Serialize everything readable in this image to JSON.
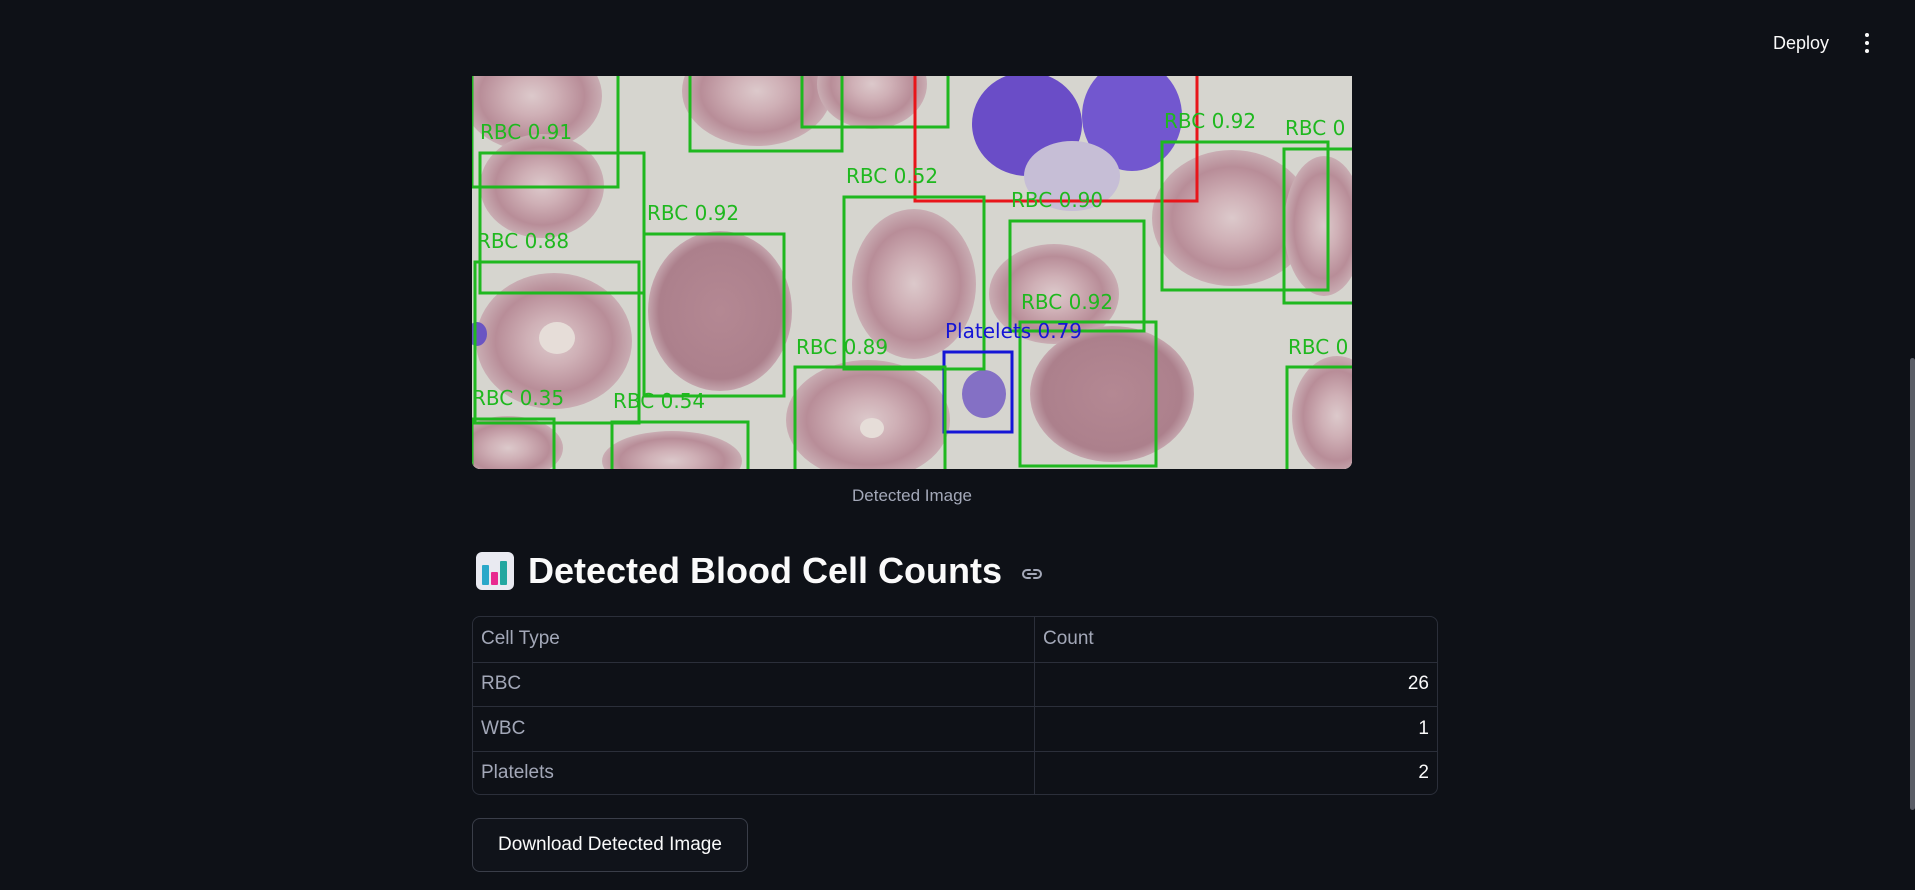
{
  "header": {
    "deploy_label": "Deploy",
    "menu_icon": "vertical-dots-icon"
  },
  "image": {
    "caption": "Detected Image",
    "detections": [
      {
        "label": "RBC 0.91",
        "class": "RBC"
      },
      {
        "label": "RBC 0.92",
        "class": "RBC"
      },
      {
        "label": "RBC 0.88",
        "class": "RBC"
      },
      {
        "label": "RBC 0.52",
        "class": "RBC"
      },
      {
        "label": "RBC 0.90",
        "class": "RBC"
      },
      {
        "label": "RBC 0.92",
        "class": "RBC"
      },
      {
        "label": "RBC 0",
        "class": "RBC"
      },
      {
        "label": "RBC 0.92",
        "class": "RBC"
      },
      {
        "label": "Platelets 0.79",
        "class": "Platelets"
      },
      {
        "label": "RBC 0.89",
        "class": "RBC"
      },
      {
        "label": "RBC 0.35",
        "class": "RBC"
      },
      {
        "label": "RBC 0.54",
        "class": "RBC"
      },
      {
        "label": "RBC 0",
        "class": "RBC"
      }
    ],
    "colors": {
      "RBC": "#1fb81f",
      "WBC": "#e8151a",
      "Platelets": "#1515d6"
    }
  },
  "section": {
    "icon": "bar-chart-icon",
    "title": "Detected Blood Cell Counts",
    "anchor_icon": "link-icon"
  },
  "table": {
    "headers": [
      "Cell Type",
      "Count"
    ],
    "rows": [
      {
        "type": "RBC",
        "count": "26"
      },
      {
        "type": "WBC",
        "count": "1"
      },
      {
        "type": "Platelets",
        "count": "2"
      }
    ]
  },
  "download": {
    "label": "Download Detected Image"
  }
}
